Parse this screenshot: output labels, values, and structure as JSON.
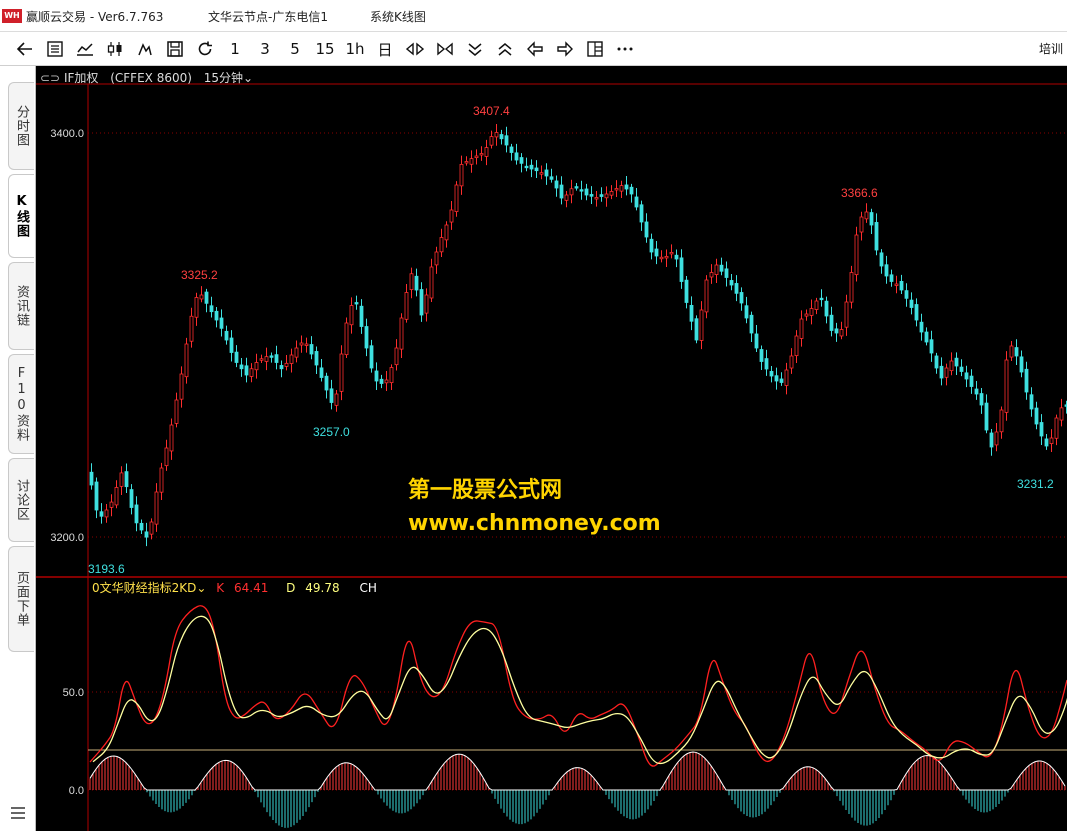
{
  "window": {
    "logo_text": "WH",
    "app_title": "赢顺云交易  -  Ver6.7.763",
    "node": "文华云节点-广东电信1",
    "view": "系统K线图"
  },
  "toolbar": {
    "periods": [
      "1",
      "3",
      "5",
      "15",
      "1h",
      "日"
    ],
    "right_label": "培训"
  },
  "sidebar": {
    "tabs": [
      "分时图",
      "K线图",
      "资讯链",
      "F10资料",
      "讨论区",
      "页面下单"
    ]
  },
  "symbol": {
    "name": "IF加权",
    "exchange_code": "(CFFEX 8600)",
    "period": "15分钟"
  },
  "price_axis": {
    "top_label": "3400.0",
    "bottom_label": "3200.0"
  },
  "price_marks": {
    "high1": "3325.2",
    "low1": "3257.0",
    "high2": "3407.4",
    "high3": "3366.6",
    "low2": "3231.2",
    "left_low": "3193.6"
  },
  "indicator": {
    "name": "0文华财经指标2KD",
    "k_label": "K",
    "k_value": "64.41",
    "d_label": "D",
    "d_value": "49.78",
    "ch_label": "CH",
    "axis_mid": "50.0",
    "axis_zero": "0.0"
  },
  "watermark": {
    "line1": "第一股票公式网",
    "line2": "www.chnmoney.com"
  },
  "colors": {
    "up": "#ff2d2d",
    "down": "#3fe0e0",
    "k_line": "#ff2020",
    "d_line": "#ffffa0",
    "axis": "#b00000"
  }
}
